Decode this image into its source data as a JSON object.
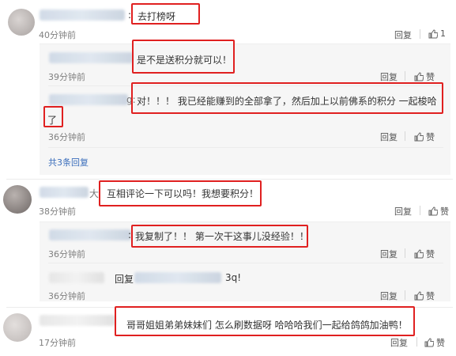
{
  "comments": [
    {
      "text": "去打榜呀",
      "colon": ":",
      "time": "40分钟前",
      "reply": "回复",
      "like_count": "1",
      "replies": [
        {
          "text": "是不是送积分就可以！",
          "time": "39分钟前",
          "reply": "回复",
          "like": "赞"
        },
        {
          "text": "对！！！ 我已经能赚到的全部拿了，然后加上以前佛系的积分 一起梭哈",
          "text2": "了",
          "time": "36分钟前",
          "reply": "回复",
          "like": "赞"
        }
      ],
      "more_replies": "共3条回复"
    },
    {
      "text": "互相评论一下可以吗！我想要积分！",
      "name_fragment": "大",
      "time": "38分钟前",
      "reply": "回复",
      "like": "赞",
      "replies": [
        {
          "text": "我复制了！！ 第一次干这事儿没经验！！",
          "time": "36分钟前",
          "reply": "回复",
          "like": "赞"
        },
        {
          "prefix": "回复",
          "suffix": "3q!",
          "time": "36分钟前",
          "reply": "回复",
          "like": "赞"
        }
      ]
    },
    {
      "text": "哥哥姐姐弟弟妹妹们 怎么刷数据呀 哈哈哈我们一起给鸽鸽加油鸭！",
      "time": "17分钟前",
      "reply": "回复",
      "like": "赞"
    }
  ],
  "icons": {
    "like": "thumbs-up-icon"
  },
  "colors": {
    "highlight": "#e02020",
    "link": "#3a6dbb",
    "reply_bg": "#f6f6f6"
  }
}
